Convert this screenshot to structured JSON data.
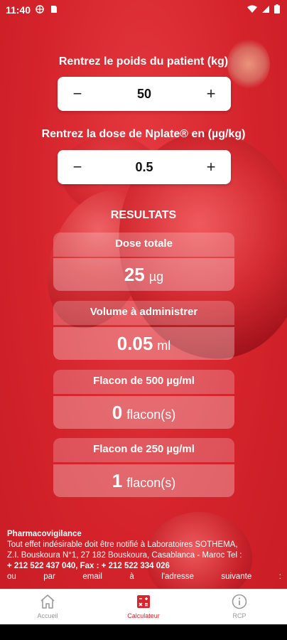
{
  "status_bar": {
    "time": "11:40"
  },
  "inputs": {
    "weight_label": "Rentrez le poids du patient (kg)",
    "weight_value": "50",
    "dose_label": "Rentrez la dose de Nplate® en (µg/kg)",
    "dose_value": "0.5",
    "minus_symbol": "−",
    "plus_symbol": "+"
  },
  "results": {
    "title": "RESULTATS",
    "items": [
      {
        "header": "Dose totale",
        "value": "25",
        "unit": "µg"
      },
      {
        "header": "Volume à administrer",
        "value": "0.05",
        "unit": "ml"
      },
      {
        "header": "Flacon de 500 µg/ml",
        "value": "0",
        "unit": "flacon(s)"
      },
      {
        "header": "Flacon de 250 µg/ml",
        "value": "1",
        "unit": "flacon(s)"
      }
    ]
  },
  "footer": {
    "heading": "Pharmacovigilance",
    "line1": "Tout effet indésirable doit être notifié à Laboratoires SOTHEMA,",
    "line2": "Z.I. Bouskoura N°1, 27 182 Bouskoura, Casablanca - Maroc Tel :",
    "line3": "+ 212 522 437 040, Fax : + 212 522 334 026",
    "line4_words": [
      "ou",
      "par",
      "email",
      "à",
      "l'adresse",
      "suivante",
      ":"
    ]
  },
  "nav": {
    "items": [
      {
        "label": "Accueil",
        "icon": "home-icon"
      },
      {
        "label": "Calculateur",
        "icon": "calculator-icon"
      },
      {
        "label": "RCP",
        "icon": "info-icon"
      }
    ],
    "active_index": 1,
    "active_color": "#d9232d",
    "inactive_color": "#9a9a9a"
  }
}
